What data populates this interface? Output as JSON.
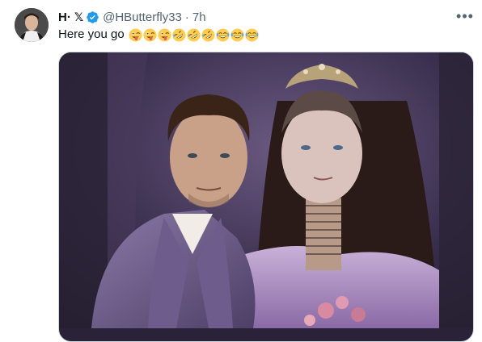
{
  "tweet": {
    "author_name": "H·",
    "x_badge": "𝕏",
    "handle": "@HButterfly33",
    "separator": "·",
    "time": "7h",
    "text": "Here you go",
    "emojis": [
      "tongue-wink",
      "tongue-wink",
      "tongue-wink",
      "rofl",
      "rofl",
      "rofl",
      "joy",
      "joy",
      "joy"
    ],
    "more_label": "•••"
  },
  "colors": {
    "text": "#0f1419",
    "secondary": "#536471",
    "verified": "#1d9bf0",
    "border": "#cfd9de"
  }
}
